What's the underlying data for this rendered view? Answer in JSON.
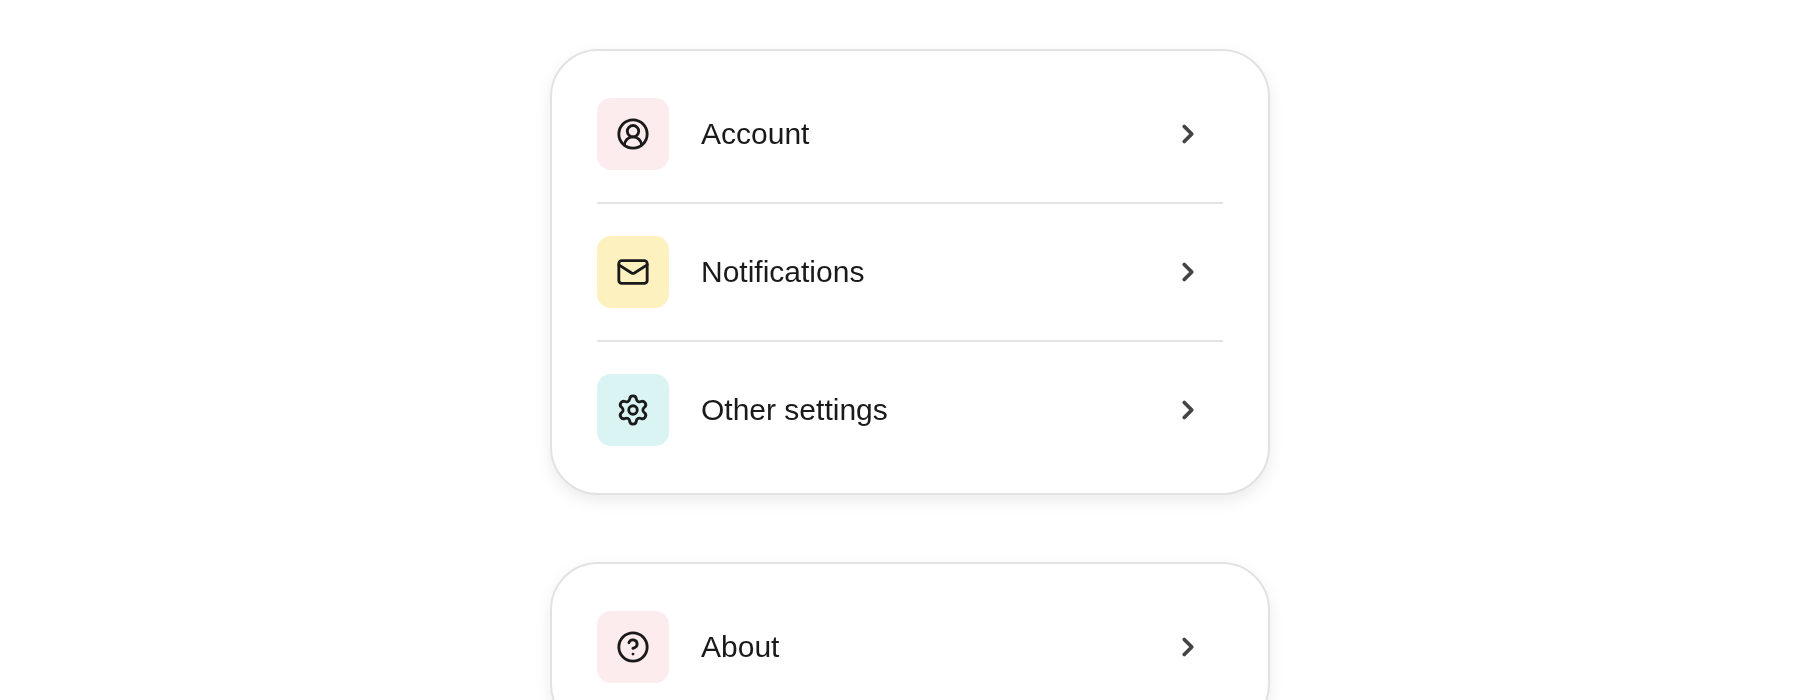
{
  "groups": [
    {
      "items": [
        {
          "kind": "account",
          "label": "Account",
          "color": "#fdecee"
        },
        {
          "kind": "mail",
          "label": "Notifications",
          "color": "#fef1c0"
        },
        {
          "kind": "settings",
          "label": "Other settings",
          "color": "#d9f4f3"
        }
      ]
    },
    {
      "items": [
        {
          "kind": "help",
          "label": "About",
          "color": "#fdecee"
        }
      ]
    }
  ]
}
